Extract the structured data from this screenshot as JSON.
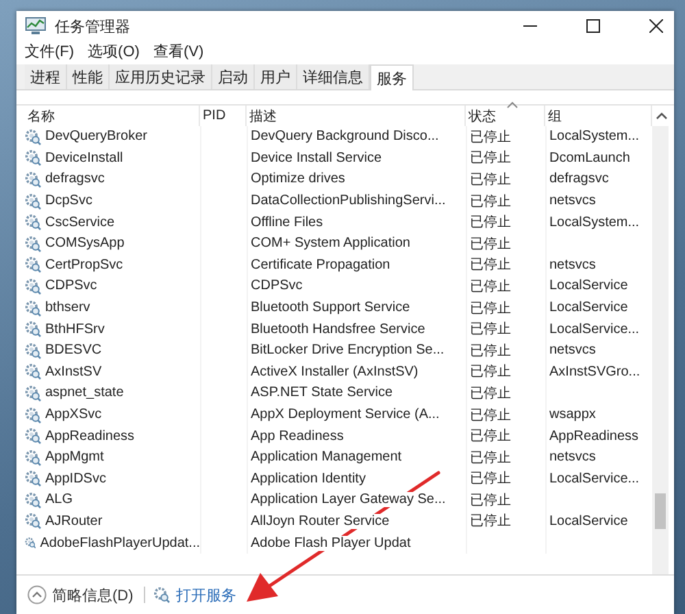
{
  "window": {
    "title": "任务管理器"
  },
  "menu": [
    "文件(F)",
    "选项(O)",
    "查看(V)"
  ],
  "tabs": [
    {
      "label": "进程",
      "selected": false
    },
    {
      "label": "性能",
      "selected": false
    },
    {
      "label": "应用历史记录",
      "selected": false
    },
    {
      "label": "启动",
      "selected": false
    },
    {
      "label": "用户",
      "selected": false
    },
    {
      "label": "详细信息",
      "selected": false
    },
    {
      "label": "服务",
      "selected": true
    }
  ],
  "table": {
    "columns": [
      {
        "label": "名称",
        "sorted": false
      },
      {
        "label": "PID",
        "sorted": false
      },
      {
        "label": "描述",
        "sorted": false
      },
      {
        "label": "状态",
        "sorted": true
      },
      {
        "label": "组",
        "sorted": false
      }
    ],
    "rows": [
      {
        "name": "DevQueryBroker",
        "description": "DevQuery Background Disco...",
        "status": "已停止",
        "group": "LocalSystem..."
      },
      {
        "name": "DeviceInstall",
        "description": "Device Install Service",
        "status": "已停止",
        "group": "DcomLaunch"
      },
      {
        "name": "defragsvc",
        "description": "Optimize drives",
        "status": "已停止",
        "group": "defragsvc"
      },
      {
        "name": "DcpSvc",
        "description": "DataCollectionPublishingServi...",
        "status": "已停止",
        "group": "netsvcs"
      },
      {
        "name": "CscService",
        "description": "Offline Files",
        "status": "已停止",
        "group": "LocalSystem..."
      },
      {
        "name": "COMSysApp",
        "description": "COM+ System Application",
        "status": "已停止"
      },
      {
        "name": "CertPropSvc",
        "description": "Certificate Propagation",
        "status": "已停止",
        "group": "netsvcs"
      },
      {
        "name": "CDPSvc",
        "description": "CDPSvc",
        "status": "已停止",
        "group": "LocalService"
      },
      {
        "name": "bthserv",
        "description": "Bluetooth Support Service",
        "status": "已停止",
        "group": "LocalService"
      },
      {
        "name": "BthHFSrv",
        "description": "Bluetooth Handsfree Service",
        "status": "已停止",
        "group": "LocalService..."
      },
      {
        "name": "BDESVC",
        "description": "BitLocker Drive Encryption Se...",
        "status": "已停止",
        "group": "netsvcs"
      },
      {
        "name": "AxInstSV",
        "description": "ActiveX Installer (AxInstSV)",
        "status": "已停止",
        "group": "AxInstSVGro..."
      },
      {
        "name": "aspnet_state",
        "description": "ASP.NET State Service",
        "status": "已停止"
      },
      {
        "name": "AppXSvc",
        "description": "AppX Deployment Service (A...",
        "status": "已停止",
        "group": "wsappx"
      },
      {
        "name": "AppReadiness",
        "description": "App Readiness",
        "status": "已停止",
        "group": "AppReadiness"
      },
      {
        "name": "AppMgmt",
        "description": "Application Management",
        "status": "已停止",
        "group": "netsvcs"
      },
      {
        "name": "AppIDSvc",
        "description": "Application Identity",
        "status": "已停止",
        "group": "LocalService..."
      },
      {
        "name": "ALG",
        "description": "Application Layer Gateway Se...",
        "status": "已停止"
      },
      {
        "name": "AJRouter",
        "description": "AllJoyn Router Service",
        "status": "已停止",
        "group": "LocalService"
      },
      {
        "name": "AdobeFlashPlayerUpdat...",
        "description": "Adobe Flash Player Updat"
      }
    ]
  },
  "footer": {
    "details_button": "简略信息(D)",
    "services_link": "打开服务"
  }
}
